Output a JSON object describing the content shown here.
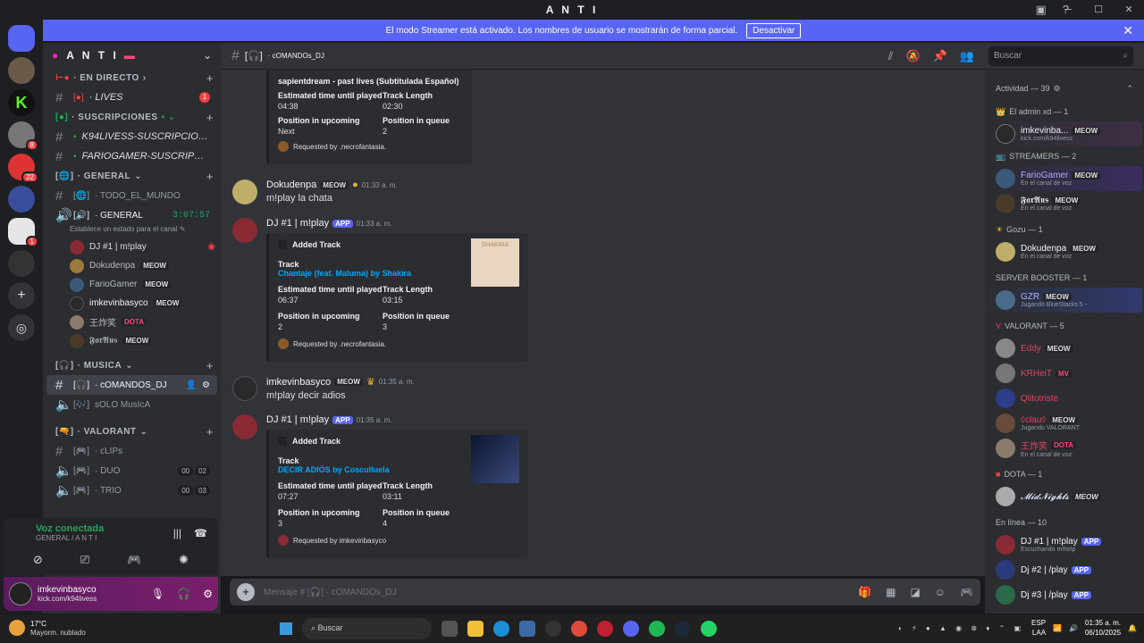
{
  "window": {
    "title": "A N T I"
  },
  "streamer": {
    "text": "El modo Streamer está activado. Los nombres de usuario se mostrarán de forma parcial.",
    "button": "Desactivar"
  },
  "server": {
    "name": "A N T I"
  },
  "channels": {
    "cat_directo": "· EN DIRECTO",
    "lives": "· LIVES",
    "lives_badge": "1",
    "cat_suscripciones": "· SUSCRIPCIONES",
    "k94": "K94LIVESS-SUSCRIPCIONE...",
    "fario": "FARIOGAMER-SUSCRIPCIO...",
    "cat_general": "· GENERAL",
    "todo": "· TODO_EL_MUNDO",
    "general_voice": "· GENERAL",
    "general_timer": "3:07:57",
    "status_prompt": "Establece un estado para el canal",
    "cat_musica": "· MUSICA",
    "comandos": "· cOMANDOS_DJ",
    "solo": "sOLO MusIcA",
    "cat_valorant": "· VALORANT",
    "clips": "· cLIPs",
    "duo": "· DUO",
    "duo_a": "00",
    "duo_b": "02",
    "trio": "· TRIO",
    "trio_a": "00",
    "trio_b": "03"
  },
  "voice_users": [
    {
      "name": "DJ #1 | m!play",
      "tag": ""
    },
    {
      "name": "Dokudenpa",
      "tag": "MEOW"
    },
    {
      "name": "FarioGamer",
      "tag": "MEOW"
    },
    {
      "name": "imkevinbasyco",
      "tag": "MEOW"
    },
    {
      "name": "王炸笑",
      "tag": "DOTA"
    },
    {
      "name": "𝕱𝖆𝖗𝕬𝖚𝖘",
      "tag": "MEOW"
    }
  ],
  "voice": {
    "status": "Voz conectada",
    "sub": "GENERAL / A N T I"
  },
  "user": {
    "name": "imkevinbasyco",
    "status": "kick.com/k94livess"
  },
  "header": {
    "channel": "· cOMANDOs_DJ",
    "search": "Buscar"
  },
  "chat": {
    "embed1": {
      "title": "sapientdream - past lives (Subtitulada Español)",
      "l1": "Estimated time until played",
      "v1": "04:38",
      "l2": "Track Length",
      "v2": "02:30",
      "l3": "Position in upcoming",
      "v3": "Next",
      "l4": "Position in queue",
      "v4": "2",
      "req": "Requested by .necrofantasia."
    },
    "m1": {
      "name": "Dokudenpa",
      "tag": "MEOW",
      "time": "01:33 a. m.",
      "text": "m!play la chata"
    },
    "m2": {
      "name": "DJ #1 | m!play",
      "app": "APP",
      "time": "01:33 a. m."
    },
    "embed2": {
      "title": "Added Track",
      "track_label": "Track",
      "track": "Chantaje (feat. Maluma) by Shakira",
      "l1": "Estimated time until played",
      "v1": "06:37",
      "l2": "Track Length",
      "v2": "03:15",
      "l3": "Position in upcoming",
      "v3": "2",
      "l4": "Position in queue",
      "v4": "3",
      "req": "Requested by .necrofantasia.",
      "thumb": "SHAKIRA"
    },
    "m3": {
      "name": "imkevinbasyco",
      "tag": "MEOW",
      "time": "01:35 a. m.",
      "text": "m!play decir adios"
    },
    "m4": {
      "name": "DJ #1 | m!play",
      "app": "APP",
      "time": "01:35 a. m."
    },
    "embed3": {
      "title": "Added Track",
      "track_label": "Track",
      "track": "DECIR ADIÓS by Cosculluela",
      "l1": "Estimated time until played",
      "v1": "07:27",
      "l2": "Track Length",
      "v2": "03:11",
      "l3": "Position in upcoming",
      "v3": "3",
      "l4": "Position in queue",
      "v4": "4",
      "req": "Requested by imkevinbasyco"
    }
  },
  "input": {
    "placeholder": "Mensaje # [🎧] · cOMANDOs_DJ"
  },
  "members": {
    "activity": "Actividad — 39",
    "admin_cat": "El admin xd — 1",
    "streamers_cat": "STREAMERS — 2",
    "gozu_cat": "Gozu — 1",
    "booster_cat": "SERVER BOOSTER — 1",
    "valorant_cat": "VALORANT — 5",
    "dota_cat": "DOTA — 1",
    "online_cat": "En línea — 10",
    "admin": {
      "name": "imkevinba...",
      "tag": "MEOW",
      "status": "kick.com/k94livess"
    },
    "s1": {
      "name": "FarioGamer",
      "tag": "MEOW",
      "status": "En el canal de voz"
    },
    "s2": {
      "name": "𝕱𝖆𝖗𝕬𝖚𝖘",
      "tag": "MEOW",
      "status": "En el canal de voz"
    },
    "g1": {
      "name": "Dokudenpa",
      "tag": "MEOW",
      "status": "En el canal de voz"
    },
    "b1": {
      "name": "GZR",
      "tag": "MEOW",
      "status": "Jugando BlueStacks 5 -"
    },
    "v1": {
      "name": "Eddy",
      "tag": "MEOW"
    },
    "v2": {
      "name": "KRHeiT",
      "tag": "MV"
    },
    "v3": {
      "name": "Qlitotriste"
    },
    "v4": {
      "name": "◊clau◊",
      "tag": "MEOW",
      "status": "Jugando VALORANT"
    },
    "v5": {
      "name": "王炸笑",
      "tag": "DOTA",
      "status": "En el canal de voz"
    },
    "d1": {
      "name": "𝓜𝓲𝓭𝓝𝓲𝓰𝓱𝓽𝓼",
      "tag": "MEOW"
    },
    "o1": {
      "name": "DJ #1 | m!play",
      "tag": "APP",
      "status": "Escuchando m!help"
    },
    "o2": {
      "name": "Dj #2 | /play",
      "tag": "APP"
    },
    "o3": {
      "name": "Dj #3 | /play",
      "tag": "APP"
    }
  },
  "taskbar": {
    "temp": "17°C",
    "weather": "Mayorm. nublado",
    "search": "Buscar",
    "lang": "ESP",
    "lang2": "LAA",
    "time": "01:35 a. m.",
    "date": "06/10/2025"
  }
}
